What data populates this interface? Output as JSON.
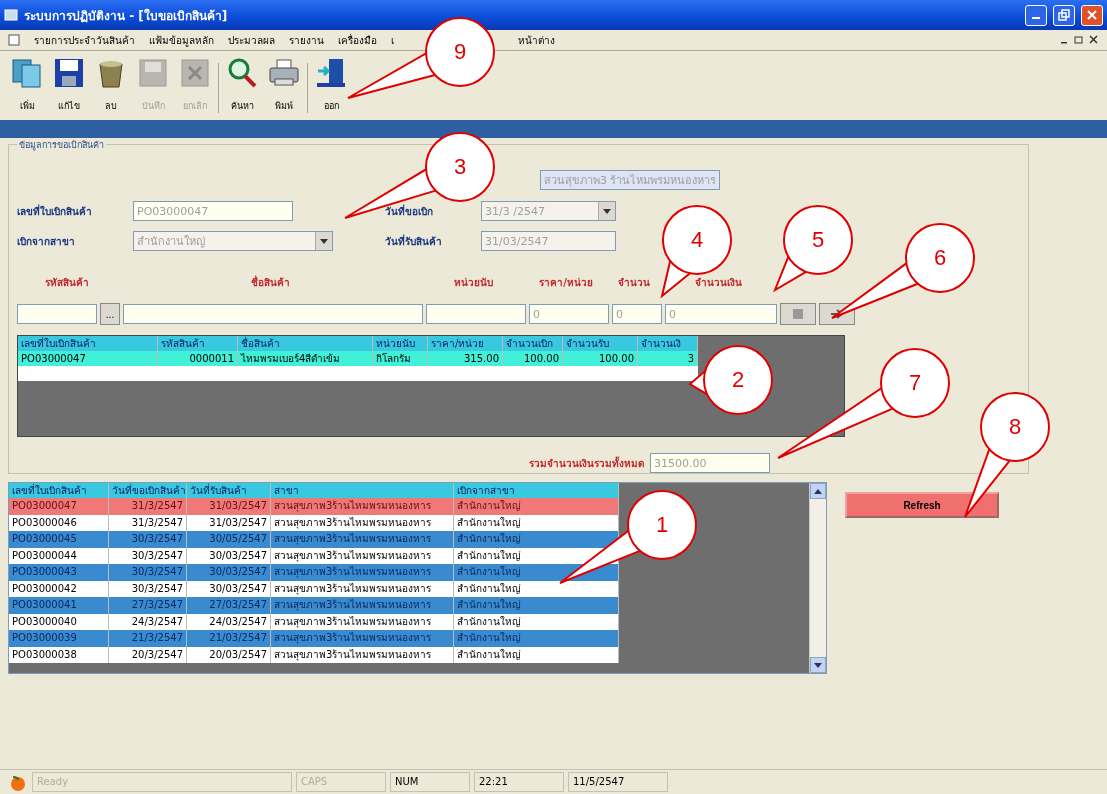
{
  "window": {
    "title": "ระบบการปฏิบัติงาน - [ใบขอเบิกสินค้า]"
  },
  "menu": [
    "รายการประจำวันสินค้า",
    "แฟ้มข้อมูลหลัก",
    "ประมวลผล",
    "รายงาน",
    "เครื่องมือ",
    "เ",
    "หน้าต่าง"
  ],
  "toolbar": [
    {
      "kind": "add",
      "label": "เพิ่ม",
      "disabled": false
    },
    {
      "kind": "edit",
      "label": "แก้ไข",
      "disabled": false
    },
    {
      "kind": "delete",
      "label": "ลบ",
      "disabled": false
    },
    {
      "kind": "save",
      "label": "บันทึก",
      "disabled": true
    },
    {
      "kind": "cancel",
      "label": "ยกเลิก",
      "disabled": true
    },
    {
      "kind": "search",
      "label": "ค้นหา",
      "disabled": false
    },
    {
      "kind": "print",
      "label": "พิมพ์",
      "disabled": false
    },
    {
      "kind": "exit",
      "label": "ออก",
      "disabled": false
    }
  ],
  "form": {
    "group_title": "ข้อมูลการขอเบิกสินค้า",
    "branch_value": "สวนสุขภาพ3 ร้านไหมพรมหนองหาร",
    "doc_no_label": "เลขที่ใบเบิกสินค้า",
    "doc_no_value": "PO03000047",
    "request_date_label": "วันที่ขอเบิก",
    "request_date_value": "31/3 /2547",
    "from_branch_label": "เบิกจากสาขา",
    "from_branch_value": "สำนักงานใหญ่",
    "receive_date_label": "วันที่รับสินค้า",
    "receive_date_value": "31/03/2547"
  },
  "entry": {
    "headers": [
      "รหัสสินค้า",
      "ชื่อสินค้า",
      "หน่วยนับ",
      "ราคา/หน่วย",
      "จำนวน",
      "จำนวนเงิน"
    ],
    "browse_button": "...",
    "price": "0",
    "quantity": "0",
    "amount": "0"
  },
  "detail_grid": {
    "columns": [
      "เลขที่ใบเบิกสินค้า",
      "รหัสสินค้า",
      "ชื่อสินค้า",
      "หน่วยนับ",
      "ราคา/หน่วย",
      "จำนวนเบิก",
      "จำนวนรับ",
      "จำนวนเงิ"
    ],
    "rows": [
      {
        "selected": true,
        "cells": [
          "PO03000047",
          "0000011",
          "ไหมพรมเบอร์4สีดำเข้ม",
          "กิโลกรัม",
          "315.00",
          "100.00",
          "100.00",
          "3"
        ]
      }
    ]
  },
  "total": {
    "label": "รวมจำนวนเงินรวมทั้งหมด",
    "value": "31500.00"
  },
  "history_grid": {
    "columns": [
      "เลขที่ใบเบิกสินค้า",
      "วันที่ขอเบิกสินค้า",
      "วันที่รับสินค้า",
      "สาขา",
      "เบิกจากสาขา"
    ],
    "rows": [
      {
        "selected": true,
        "cells": [
          "PO03000047",
          "31/3/2547",
          "31/03/2547",
          "สวนสุขภาพ3ร้านไหมพรมหนองหาร",
          "สำนักงานใหญ่"
        ]
      },
      {
        "selected": false,
        "cells": [
          "PO03000046",
          "31/3/2547",
          "31/03/2547",
          "สวนสุขภาพ3ร้านไหมพรมหนองหาร",
          "สำนักงานใหญ่"
        ]
      },
      {
        "selected": false,
        "cells": [
          "PO03000045",
          "30/3/2547",
          "30/05/2547",
          "สวนสุขภาพ3ร้านไหมพรมหนองหาร",
          "สำนักงานใหญ่"
        ]
      },
      {
        "selected": false,
        "cells": [
          "PO03000044",
          "30/3/2547",
          "30/03/2547",
          "สวนสุขภาพ3ร้านไหมพรมหนองหาร",
          "สำนักงานใหญ่"
        ]
      },
      {
        "selected": false,
        "cells": [
          "PO03000043",
          "30/3/2547",
          "30/03/2547",
          "สวนสุขภาพ3ร้านไหมพรมหนองหาร",
          "สำนักงานใหญ่"
        ]
      },
      {
        "selected": false,
        "cells": [
          "PO03000042",
          "30/3/2547",
          "30/03/2547",
          "สวนสุขภาพ3ร้านไหมพรมหนองหาร",
          "สำนักงานใหญ่"
        ]
      },
      {
        "selected": false,
        "cells": [
          "PO03000041",
          "27/3/2547",
          "27/03/2547",
          "สวนสุขภาพ3ร้านไหมพรมหนองหาร",
          "สำนักงานใหญ่"
        ]
      },
      {
        "selected": false,
        "cells": [
          "PO03000040",
          "24/3/2547",
          "24/03/2547",
          "สวนสุขภาพ3ร้านไหมพรมหนองหาร",
          "สำนักงานใหญ่"
        ]
      },
      {
        "selected": false,
        "cells": [
          "PO03000039",
          "21/3/2547",
          "21/03/2547",
          "สวนสุขภาพ3ร้านไหมพรมหนองหาร",
          "สำนักงานใหญ่"
        ]
      },
      {
        "selected": false,
        "cells": [
          "PO03000038",
          "20/3/2547",
          "20/03/2547",
          "สวนสุขภาพ3ร้านไหมพรมหนองหาร",
          "สำนักงานใหญ่"
        ]
      }
    ]
  },
  "refresh_button": "Refresh",
  "status_bar": [
    {
      "text": "Ready",
      "disabled": true
    },
    {
      "text": "CAPS",
      "disabled": true
    },
    {
      "text": "NUM",
      "disabled": false
    },
    {
      "text": "22:21",
      "disabled": false
    },
    {
      "text": "11/5/2547",
      "disabled": false
    }
  ],
  "callouts": [
    "1",
    "2",
    "3",
    "4",
    "5",
    "6",
    "7",
    "8",
    "9"
  ]
}
